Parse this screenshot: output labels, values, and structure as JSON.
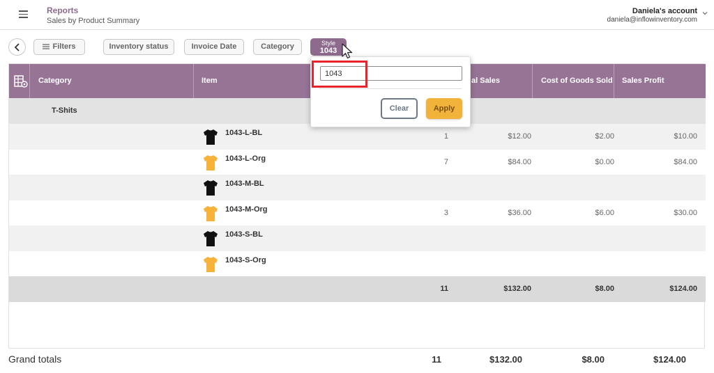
{
  "header": {
    "title": "Reports",
    "subtitle": "Sales by Product Summary",
    "account_name": "Daniela's account",
    "account_email": "daniela@inflowinventory.com"
  },
  "filters": {
    "filters_label": "Filters",
    "inventory_status": "Inventory status",
    "invoice_date": "Invoice Date",
    "category": "Category",
    "style_label": "Style",
    "style_value": "1043"
  },
  "popup": {
    "input_value": "1043",
    "clear_label": "Clear",
    "apply_label": "Apply"
  },
  "table": {
    "headers": {
      "category": "Category",
      "item": "Item",
      "total_sales": "al Sales",
      "cogs": "Cost of Goods Sold",
      "sales_profit": "Sales Profit"
    },
    "group_name": "T-Shits",
    "rows": [
      {
        "item": "1043-L-BL",
        "color": "black",
        "qty": "1",
        "sales": "$12.00",
        "cogs": "$2.00",
        "profit": "$10.00"
      },
      {
        "item": "1043-L-Org",
        "color": "orange",
        "qty": "7",
        "sales": "$84.00",
        "cogs": "$0.00",
        "profit": "$84.00"
      },
      {
        "item": "1043-M-BL",
        "color": "black",
        "qty": "",
        "sales": "",
        "cogs": "",
        "profit": ""
      },
      {
        "item": "1043-M-Org",
        "color": "orange",
        "qty": "3",
        "sales": "$36.00",
        "cogs": "$6.00",
        "profit": "$30.00"
      },
      {
        "item": "1043-S-BL",
        "color": "black",
        "qty": "",
        "sales": "",
        "cogs": "",
        "profit": ""
      },
      {
        "item": "1043-S-Org",
        "color": "orange",
        "qty": "",
        "sales": "",
        "cogs": "",
        "profit": ""
      }
    ],
    "subtotal": {
      "qty": "11",
      "sales": "$132.00",
      "cogs": "$8.00",
      "profit": "$124.00"
    }
  },
  "grand_totals": {
    "label": "Grand totals",
    "qty": "11",
    "sales": "$132.00",
    "cogs": "$8.00",
    "profit": "$124.00"
  },
  "colors": {
    "header_purple": "#977496",
    "accent_purple": "#8e6b8e",
    "apply_orange": "#f2b33a",
    "highlight_red": "#e8242a",
    "shirt_black": "#111111",
    "shirt_orange": "#f7b23b"
  },
  "icons": {
    "menu": "hamburger-icon",
    "account_chevron": "chevron-down-icon",
    "back": "chevron-left-icon",
    "filters": "filter-lines-icon",
    "table_config": "table-settings-icon",
    "item_image": "tshirt-icon",
    "pointer": "mouse-cursor-icon"
  }
}
